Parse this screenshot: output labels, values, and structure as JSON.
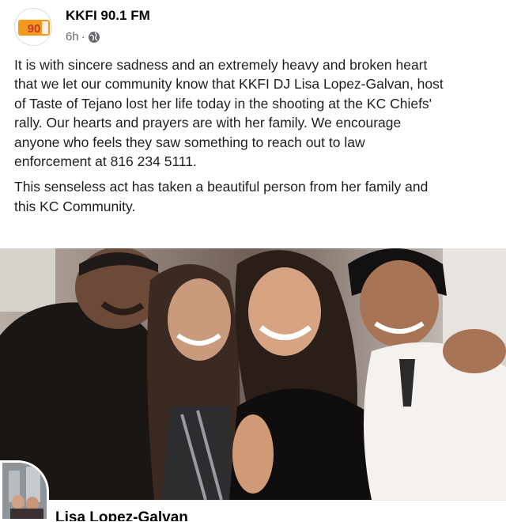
{
  "post": {
    "page_name": "KKFI 90.1 FM",
    "timestamp": "6h",
    "separator": "·",
    "privacy_icon": "globe-icon",
    "avatar_text": "90.1",
    "paragraphs": [
      "It is with sincere sadness and an extremely heavy and broken heart\nthat we let our community know that KKFI DJ Lisa Lopez-Galvan, host\nof Taste of Tejano lost her life  today in the shooting at the KC Chiefs'\nrally. Our hearts and prayers are with her family.  We encourage\nanyone who feels they saw something to reach out to law\nenforcement at 816 234 5111.",
      "This senseless act has taken a beautiful person from her family and\nthis KC Community."
    ],
    "photo_alt": "family-photo"
  },
  "linked_profile": {
    "name": "Lisa Lopez-Galvan"
  },
  "colors": {
    "brand_orange": "#f39a1e",
    "text_secondary": "#65676b"
  }
}
